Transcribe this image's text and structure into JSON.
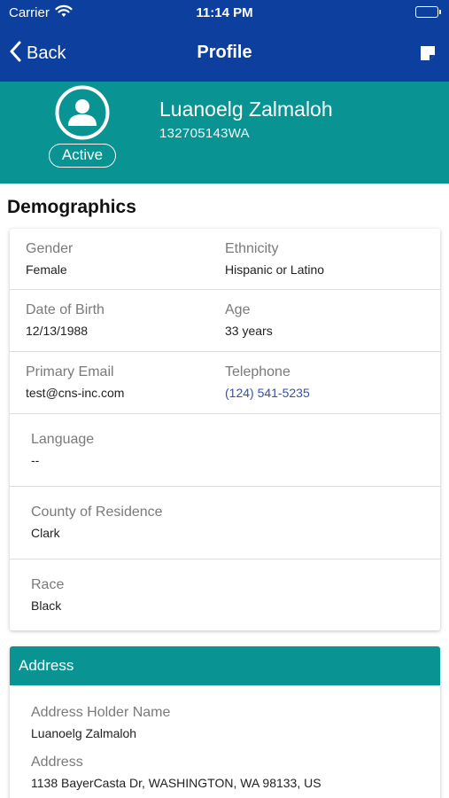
{
  "status_bar": {
    "carrier": "Carrier",
    "time": "11:14 PM"
  },
  "nav": {
    "back_label": "Back",
    "title": "Profile"
  },
  "profile": {
    "name": "Luanoelg Zalmaloh",
    "id": "132705143WA",
    "status": "Active"
  },
  "demographics": {
    "title": "Demographics",
    "gender_label": "Gender",
    "gender_value": "Female",
    "ethnicity_label": "Ethnicity",
    "ethnicity_value": "Hispanic or Latino",
    "dob_label": "Date of Birth",
    "dob_value": "12/13/1988",
    "age_label": "Age",
    "age_value": "33 years",
    "email_label": "Primary Email",
    "email_value": "test@cns-inc.com",
    "phone_label": "Telephone",
    "phone_value": "(124) 541-5235",
    "language_label": "Language",
    "language_value": "--",
    "county_label": "County of Residence",
    "county_value": "Clark",
    "race_label": "Race",
    "race_value": "Black"
  },
  "address": {
    "header": "Address",
    "holder_label": "Address Holder Name",
    "holder_value": "Luanoelg Zalmaloh",
    "address_label": "Address",
    "address_value": "1138 BayerCasta Dr, WASHINGTON, WA 98133, US"
  },
  "colors": {
    "nav": "#0d3f9e",
    "teal": "#0a9393",
    "link": "#3a4fa3"
  },
  "icons": {
    "wifi": "wifi-icon",
    "battery": "battery-icon",
    "back": "chevron-left-icon",
    "notes": "note-icon",
    "avatar": "user-avatar-icon"
  }
}
